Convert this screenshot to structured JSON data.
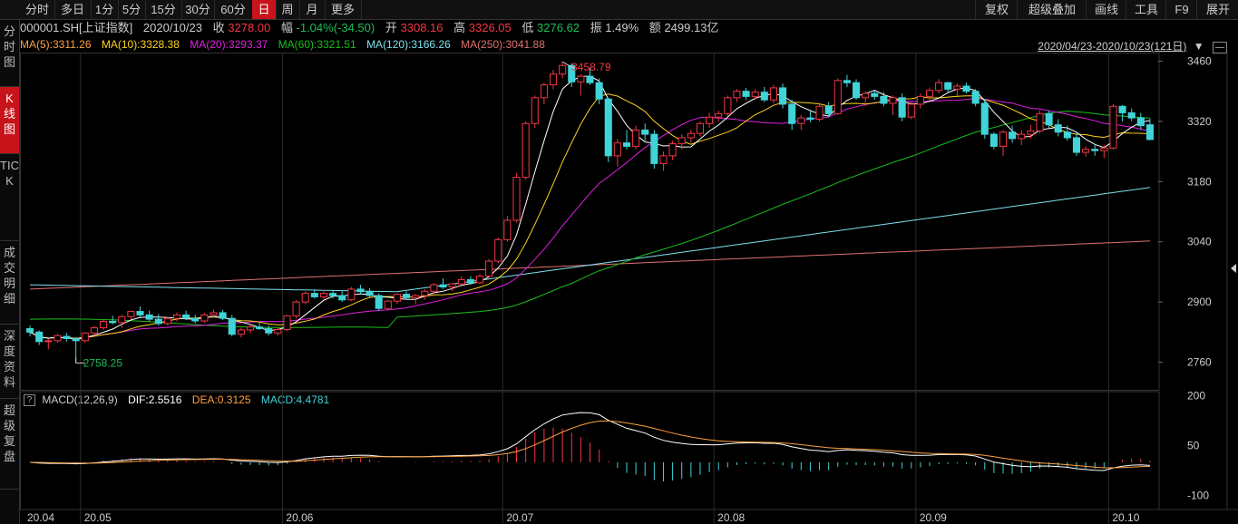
{
  "toolbar": {
    "periods": [
      "分时",
      "多日",
      "1分",
      "5分",
      "15分",
      "30分",
      "60分",
      "日",
      "周",
      "月",
      "更多"
    ],
    "active_period": "日",
    "right_buttons": [
      "复权",
      "超级叠加",
      "画线",
      "工具",
      "F9",
      "展开"
    ]
  },
  "sidebar": {
    "items": [
      "分时图",
      "K线图",
      "TICK",
      "成交明细",
      "深度资料",
      "超级复盘"
    ],
    "active_item": "K线图"
  },
  "quote": {
    "code": "000001.SH[上证指数]",
    "date": "2020/10/23",
    "close_label": "收",
    "close": "3278.00",
    "change_label": "幅",
    "change": "-1.04%(-34.50)",
    "open_label": "开",
    "open": "3308.16",
    "high_label": "高",
    "high": "3326.05",
    "low_label": "低",
    "low": "3276.62",
    "amplitude_label": "振",
    "amplitude": "1.49%",
    "amount_label": "额",
    "amount": "2499.13亿"
  },
  "ma": {
    "ma5": "MA(5):3311.26",
    "ma10": "MA(10):3328.38",
    "ma20": "MA(20):3293.37",
    "ma60": "MA(60):3321.51",
    "ma120": "MA(120):3166.26",
    "ma250": "MA(250):3041.88"
  },
  "range": "2020/04/23-2020/10/23(121日)",
  "colors": {
    "up": "#f23645",
    "down": "#40d3d8",
    "ma5": "#ffffff",
    "ma10": "#ffd21e",
    "ma20": "#e020e0",
    "ma60": "#1bbf1b",
    "ma120": "#7fe0f0",
    "ma250": "#e07070",
    "dif": "#ffffff",
    "dea": "#ffa040"
  },
  "macd": {
    "label": "MACD(12,26,9)",
    "dif": "DIF:2.5516",
    "dea": "DEA:0.3125",
    "macd": "MACD:4.4781"
  },
  "chart_data": {
    "type": "candlestick",
    "price_ticks": [
      "3460",
      "3320",
      "3180",
      "3040",
      "2900",
      "2760"
    ],
    "price_range": [
      2700,
      3480
    ],
    "macd_ticks": [
      "200",
      "50",
      "-100"
    ],
    "date_labels": [
      "20.04",
      "20.05",
      "20.06",
      "20.07",
      "20.08",
      "20.09",
      "20.10"
    ],
    "annotations": {
      "high": "3458.79",
      "low": "2758.25"
    },
    "candles": [
      [
        2838,
        2845,
        2820,
        2830
      ],
      [
        2830,
        2834,
        2800,
        2808
      ],
      [
        2808,
        2815,
        2790,
        2810
      ],
      [
        2810,
        2826,
        2805,
        2822
      ],
      [
        2820,
        2828,
        2808,
        2815
      ],
      [
        2815,
        2818,
        2758,
        2810
      ],
      [
        2810,
        2830,
        2805,
        2828
      ],
      [
        2828,
        2845,
        2822,
        2840
      ],
      [
        2840,
        2860,
        2835,
        2855
      ],
      [
        2855,
        2868,
        2848,
        2852
      ],
      [
        2852,
        2870,
        2840,
        2866
      ],
      [
        2866,
        2880,
        2860,
        2878
      ],
      [
        2878,
        2890,
        2865,
        2870
      ],
      [
        2870,
        2880,
        2855,
        2860
      ],
      [
        2860,
        2872,
        2845,
        2850
      ],
      [
        2850,
        2865,
        2845,
        2862
      ],
      [
        2862,
        2876,
        2855,
        2870
      ],
      [
        2870,
        2880,
        2858,
        2862
      ],
      [
        2862,
        2870,
        2850,
        2856
      ],
      [
        2856,
        2875,
        2852,
        2870
      ],
      [
        2870,
        2882,
        2864,
        2875
      ],
      [
        2875,
        2882,
        2858,
        2862
      ],
      [
        2862,
        2870,
        2820,
        2825
      ],
      [
        2825,
        2840,
        2818,
        2835
      ],
      [
        2835,
        2848,
        2828,
        2842
      ],
      [
        2842,
        2852,
        2835,
        2838
      ],
      [
        2838,
        2845,
        2822,
        2828
      ],
      [
        2828,
        2840,
        2822,
        2836
      ],
      [
        2836,
        2870,
        2832,
        2868
      ],
      [
        2868,
        2905,
        2862,
        2900
      ],
      [
        2900,
        2925,
        2895,
        2920
      ],
      [
        2920,
        2930,
        2908,
        2912
      ],
      [
        2912,
        2925,
        2905,
        2920
      ],
      [
        2920,
        2928,
        2908,
        2915
      ],
      [
        2915,
        2925,
        2900,
        2905
      ],
      [
        2905,
        2935,
        2902,
        2930
      ],
      [
        2930,
        2940,
        2918,
        2924
      ],
      [
        2924,
        2932,
        2910,
        2915
      ],
      [
        2915,
        2920,
        2880,
        2885
      ],
      [
        2885,
        2905,
        2880,
        2902
      ],
      [
        2902,
        2920,
        2895,
        2918
      ],
      [
        2918,
        2925,
        2905,
        2910
      ],
      [
        2910,
        2918,
        2895,
        2915
      ],
      [
        2915,
        2930,
        2905,
        2925
      ],
      [
        2925,
        2945,
        2918,
        2940
      ],
      [
        2940,
        2955,
        2930,
        2935
      ],
      [
        2935,
        2945,
        2925,
        2942
      ],
      [
        2942,
        2960,
        2935,
        2952
      ],
      [
        2952,
        2960,
        2940,
        2945
      ],
      [
        2945,
        2965,
        2942,
        2960
      ],
      [
        2960,
        3000,
        2955,
        2995
      ],
      [
        2995,
        3050,
        2990,
        3045
      ],
      [
        3045,
        3100,
        3040,
        3090
      ],
      [
        3090,
        3200,
        3085,
        3190
      ],
      [
        3190,
        3320,
        3185,
        3315
      ],
      [
        3315,
        3380,
        3305,
        3375
      ],
      [
        3375,
        3410,
        3360,
        3405
      ],
      [
        3405,
        3440,
        3395,
        3430
      ],
      [
        3430,
        3458,
        3420,
        3450
      ],
      [
        3450,
        3455,
        3400,
        3412
      ],
      [
        3412,
        3430,
        3380,
        3425
      ],
      [
        3425,
        3445,
        3405,
        3410
      ],
      [
        3410,
        3420,
        3360,
        3372
      ],
      [
        3372,
        3375,
        3225,
        3240
      ],
      [
        3240,
        3280,
        3215,
        3270
      ],
      [
        3270,
        3300,
        3255,
        3262
      ],
      [
        3262,
        3310,
        3255,
        3300
      ],
      [
        3300,
        3315,
        3275,
        3290
      ],
      [
        3290,
        3300,
        3210,
        3222
      ],
      [
        3222,
        3250,
        3205,
        3240
      ],
      [
        3240,
        3275,
        3230,
        3268
      ],
      [
        3268,
        3290,
        3255,
        3282
      ],
      [
        3282,
        3300,
        3270,
        3292
      ],
      [
        3292,
        3320,
        3285,
        3315
      ],
      [
        3315,
        3340,
        3305,
        3330
      ],
      [
        3330,
        3345,
        3320,
        3338
      ],
      [
        3338,
        3380,
        3332,
        3375
      ],
      [
        3375,
        3395,
        3365,
        3390
      ],
      [
        3390,
        3398,
        3370,
        3378
      ],
      [
        3378,
        3395,
        3370,
        3388
      ],
      [
        3388,
        3400,
        3365,
        3370
      ],
      [
        3370,
        3405,
        3362,
        3398
      ],
      [
        3398,
        3408,
        3350,
        3360
      ],
      [
        3360,
        3370,
        3300,
        3315
      ],
      [
        3315,
        3335,
        3300,
        3328
      ],
      [
        3328,
        3345,
        3318,
        3325
      ],
      [
        3325,
        3360,
        3320,
        3355
      ],
      [
        3355,
        3365,
        3330,
        3338
      ],
      [
        3338,
        3420,
        3335,
        3415
      ],
      [
        3415,
        3428,
        3400,
        3410
      ],
      [
        3410,
        3418,
        3370,
        3375
      ],
      [
        3375,
        3390,
        3355,
        3385
      ],
      [
        3385,
        3392,
        3370,
        3378
      ],
      [
        3378,
        3388,
        3355,
        3362
      ],
      [
        3362,
        3380,
        3335,
        3375
      ],
      [
        3375,
        3385,
        3320,
        3330
      ],
      [
        3330,
        3365,
        3325,
        3360
      ],
      [
        3360,
        3385,
        3350,
        3378
      ],
      [
        3378,
        3398,
        3368,
        3392
      ],
      [
        3392,
        3418,
        3385,
        3410
      ],
      [
        3410,
        3412,
        3385,
        3395
      ],
      [
        3395,
        3408,
        3380,
        3402
      ],
      [
        3402,
        3410,
        3385,
        3390
      ],
      [
        3390,
        3395,
        3355,
        3362
      ],
      [
        3362,
        3372,
        3280,
        3290
      ],
      [
        3290,
        3295,
        3255,
        3262
      ],
      [
        3262,
        3300,
        3240,
        3295
      ],
      [
        3295,
        3310,
        3270,
        3280
      ],
      [
        3280,
        3300,
        3265,
        3290
      ],
      [
        3290,
        3312,
        3280,
        3298
      ],
      [
        3298,
        3345,
        3292,
        3338
      ],
      [
        3338,
        3345,
        3305,
        3312
      ],
      [
        3312,
        3325,
        3285,
        3295
      ],
      [
        3295,
        3310,
        3275,
        3282
      ],
      [
        3282,
        3295,
        3240,
        3248
      ],
      [
        3248,
        3262,
        3238,
        3255
      ],
      [
        3255,
        3268,
        3240,
        3252
      ],
      [
        3252,
        3265,
        3235,
        3258
      ],
      [
        3258,
        3360,
        3255,
        3355
      ],
      [
        3355,
        3358,
        3320,
        3340
      ],
      [
        3340,
        3350,
        3320,
        3328
      ],
      [
        3328,
        3340,
        3300,
        3310
      ],
      [
        3312,
        3326,
        3276,
        3278
      ]
    ]
  }
}
